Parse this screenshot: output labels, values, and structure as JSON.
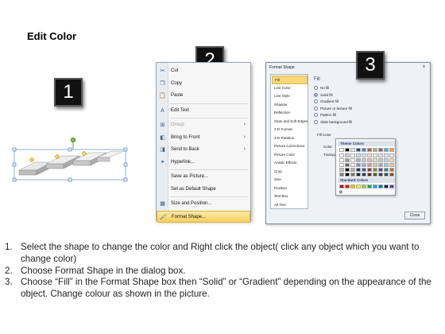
{
  "title": "Edit Color",
  "callouts": [
    "1",
    "2",
    "3"
  ],
  "context_menu": {
    "items": [
      {
        "label": "Cut",
        "icon": "scissors-icon",
        "glyph": "✂",
        "submenu": false,
        "disabled": false,
        "selected": false
      },
      {
        "label": "Copy",
        "icon": "copy-icon",
        "glyph": "❐",
        "submenu": false,
        "disabled": false,
        "selected": false
      },
      {
        "label": "Paste",
        "icon": "paste-icon",
        "glyph": "📋",
        "submenu": false,
        "disabled": false,
        "selected": false
      },
      {
        "label": "Edit Text",
        "icon": "edit-text-icon",
        "glyph": "A",
        "submenu": false,
        "disabled": false,
        "selected": false
      },
      {
        "label": "Group",
        "icon": "group-icon",
        "glyph": "⊞",
        "submenu": true,
        "disabled": true,
        "selected": false
      },
      {
        "label": "Bring to Front",
        "icon": "bring-to-front-icon",
        "glyph": "◧",
        "submenu": true,
        "disabled": false,
        "selected": false
      },
      {
        "label": "Send to Back",
        "icon": "send-to-back-icon",
        "glyph": "◨",
        "submenu": true,
        "disabled": false,
        "selected": false
      },
      {
        "label": "Hyperlink...",
        "icon": "hyperlink-icon",
        "glyph": "⚭",
        "submenu": false,
        "disabled": false,
        "selected": false
      },
      {
        "label": "Save as Picture...",
        "icon": "",
        "glyph": "",
        "submenu": false,
        "disabled": false,
        "selected": false
      },
      {
        "label": "Set as Default Shape",
        "icon": "",
        "glyph": "",
        "submenu": false,
        "disabled": false,
        "selected": false
      },
      {
        "label": "Size and Position...",
        "icon": "size-position-icon",
        "glyph": "▦",
        "submenu": false,
        "disabled": false,
        "selected": false
      },
      {
        "label": "Format Shape...",
        "icon": "format-shape-icon",
        "glyph": "🖌",
        "submenu": false,
        "disabled": false,
        "selected": true
      }
    ]
  },
  "dialog": {
    "title": "Format Shape",
    "close_glyph": "x",
    "categories": [
      "Fill",
      "Line Color",
      "Line Style",
      "Shadow",
      "Reflection",
      "Glow and Soft Edges",
      "3-D Format",
      "3-D Rotation",
      "Picture Corrections",
      "Picture Color",
      "Artistic Effects",
      "Crop",
      "Size",
      "Position",
      "Text Box",
      "Alt Text"
    ],
    "selected_category": "Fill",
    "fill_heading": "Fill",
    "options": [
      {
        "label": "No fill",
        "checked": false
      },
      {
        "label": "Solid fill",
        "checked": true
      },
      {
        "label": "Gradient fill",
        "checked": false
      },
      {
        "label": "Picture or texture fill",
        "checked": false
      },
      {
        "label": "Pattern fill",
        "checked": false
      },
      {
        "label": "Slide background fill",
        "checked": false
      }
    ],
    "fill_color_heading": "Fill Color",
    "color_label": "Color:",
    "transparency_label": "Transparency:",
    "close_button": "Close",
    "palette": {
      "theme_heading": "Theme Colors",
      "standard_heading": "Standard Colors",
      "more_colors_glyph": "✪",
      "theme_row": [
        "#ffffff",
        "#000000",
        "#eeece1",
        "#1f497d",
        "#4f81bd",
        "#c0504d",
        "#9bbb59",
        "#8064a2",
        "#4bacc6",
        "#f79646"
      ],
      "standard_row": [
        "#c00000",
        "#ff0000",
        "#ffc000",
        "#ffff00",
        "#92d050",
        "#00b050",
        "#00b0f0",
        "#0070c0",
        "#002060",
        "#7030a0"
      ]
    }
  },
  "instructions": [
    {
      "num": "1.",
      "text": "Select the shape to change the color and Right click the object( click any object which you want to change color)"
    },
    {
      "num": "2.",
      "text": "Choose Format Shape in the dialog box."
    },
    {
      "num": "3.",
      "text": "Choose “Fill” in the Format Shape box then “Solid” or “Gradient” depending on the appearance of the object. Change colour as shown in the picture."
    }
  ]
}
